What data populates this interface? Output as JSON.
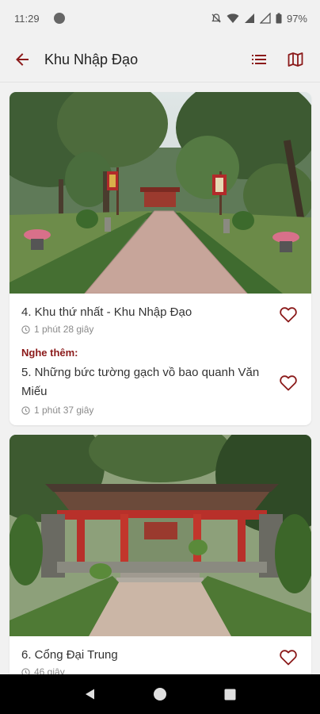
{
  "status_bar": {
    "time": "11:29",
    "battery": "97%"
  },
  "app_bar": {
    "title": "Khu Nhập Đạo"
  },
  "colors": {
    "accent": "#8b1a1a",
    "background": "#f1f1f1"
  },
  "cards": [
    {
      "image_desc": "temple-garden-path",
      "track": {
        "title": "4. Khu thứ nhất - Khu Nhập Đạo",
        "duration": "1 phút 28 giây"
      },
      "more_label": "Nghe thêm:",
      "more_track": {
        "title": "5. Những bức tường gạch vồ bao quanh Văn Miếu",
        "duration": "1 phút 37 giây"
      }
    },
    {
      "image_desc": "temple-gate",
      "track": {
        "title": "6. Cổng Đại Trung",
        "duration": "46 giây"
      }
    }
  ]
}
